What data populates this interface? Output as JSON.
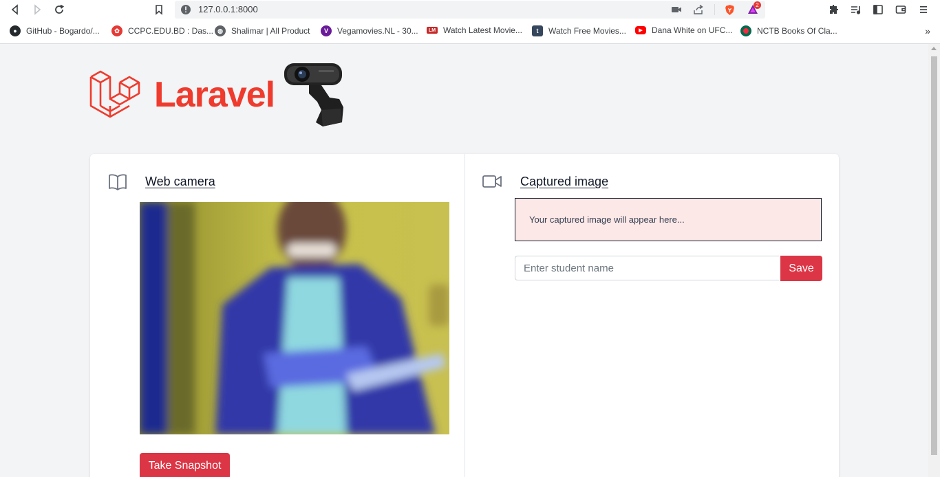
{
  "browser": {
    "url": "127.0.0.1:8000",
    "bookmarks": [
      {
        "label": "GitHub - Bogardo/...",
        "icon": "github-icon",
        "color": "#24292e"
      },
      {
        "label": "CCPC.EDU.BD : Das...",
        "icon": "ccpc-icon",
        "color": "#e53935"
      },
      {
        "label": "Shalimar | All Product",
        "icon": "globe-icon",
        "color": "#5f6368"
      },
      {
        "label": "Vegamovies.NL - 30...",
        "icon": "vegamovies-icon",
        "color": "#6a1b9a"
      },
      {
        "label": "Watch Latest Movie...",
        "icon": "lm-icon",
        "color": "#c62828"
      },
      {
        "label": "Watch Free Movies...",
        "icon": "tumblr-icon",
        "color": "#36465d"
      },
      {
        "label": "Dana White on UFC...",
        "icon": "youtube-icon",
        "color": "#ff0000"
      },
      {
        "label": "NCTB Books Of Cla...",
        "icon": "bangladesh-flag-icon",
        "color": "#006a4e"
      }
    ],
    "brave_badge_count": "2"
  },
  "header": {
    "logo_text": "Laravel",
    "logo_color": "#ef3b2d"
  },
  "left_panel": {
    "title": "Web camera",
    "icon": "book-icon",
    "snapshot_label": "Take Snapshot"
  },
  "right_panel": {
    "title": "Captured image",
    "icon": "video-camera-icon",
    "placeholder_message": "Your captured image will appear here...",
    "name_input_placeholder": "Enter student name",
    "name_input_value": "",
    "save_label": "Save"
  },
  "colors": {
    "accent": "#dc3545",
    "page_bg": "#f3f4f6",
    "result_box_bg": "#fde8e8"
  }
}
